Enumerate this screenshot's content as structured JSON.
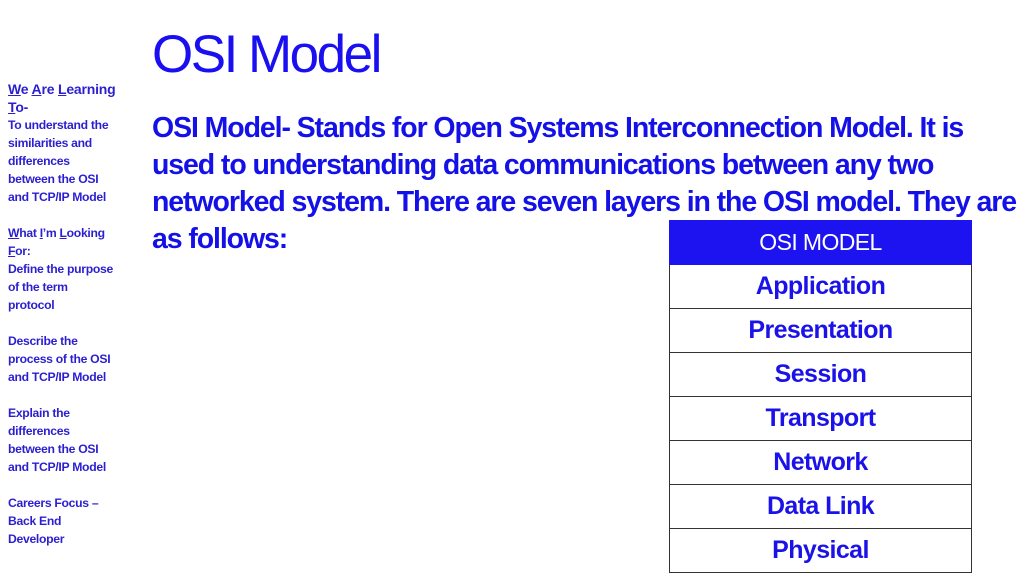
{
  "sidebar": {
    "learning_heading": {
      "parts": [
        "W",
        "e ",
        "A",
        "re ",
        "L",
        "earning "
      ],
      "to": [
        "T",
        "o-"
      ]
    },
    "learning_items": [
      "To understand the",
      "similarities and",
      "differences",
      "between the OSI",
      "and TCP/IP Model"
    ],
    "looking_heading": {
      "parts": [
        "W",
        "hat ",
        "I",
        "’m ",
        "L",
        "ooking "
      ],
      "for": [
        "F",
        "or:"
      ]
    },
    "goals": [
      [
        "Define the purpose",
        "of the term",
        "protocol"
      ],
      [
        "Describe the",
        "process of the OSI",
        "and TCP/IP Model"
      ],
      [
        "Explain the",
        "differences",
        "between the OSI",
        "and TCP/IP Model"
      ],
      [
        "Careers Focus –",
        "Back End",
        "Developer"
      ]
    ]
  },
  "slide": {
    "title": "OSI Model",
    "body": "OSI Model- Stands for Open Systems Interconnection Model. It is used to understanding data communications between any two networked system. There are seven layers in the OSI model. They are as follows:"
  },
  "osi_table": {
    "header": "OSI MODEL",
    "layers": [
      "Application",
      "Presentation",
      "Session",
      "Transport",
      "Network",
      "Data Link",
      "Physical"
    ]
  }
}
